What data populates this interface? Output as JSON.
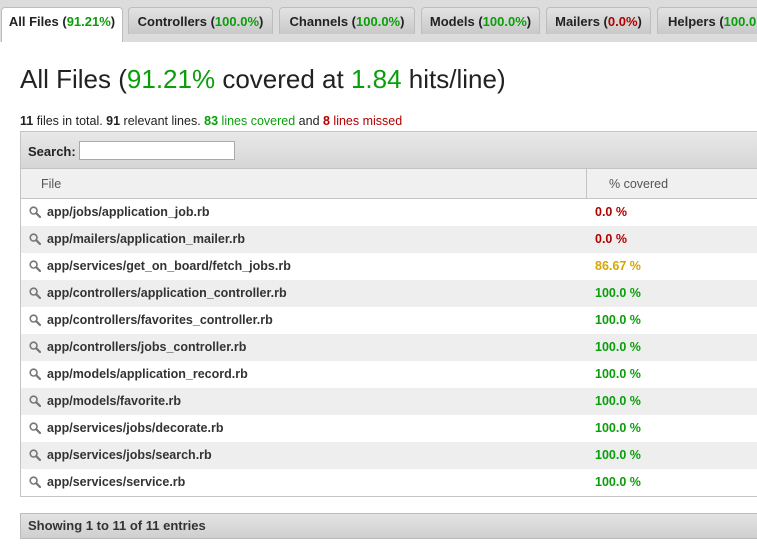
{
  "tabs": [
    {
      "label": "All Files",
      "pct": "91.21%",
      "pct_color": "green",
      "active": true
    },
    {
      "label": "Controllers",
      "pct": "100.0%",
      "pct_color": "green",
      "active": false
    },
    {
      "label": "Channels",
      "pct": "100.0%",
      "pct_color": "green",
      "active": false
    },
    {
      "label": "Models",
      "pct": "100.0%",
      "pct_color": "green",
      "active": false
    },
    {
      "label": "Mailers",
      "pct": "0.0%",
      "pct_color": "red",
      "active": false
    },
    {
      "label": "Helpers",
      "pct": "100.0",
      "pct_color": "green",
      "active": false
    }
  ],
  "header": {
    "title_prefix": "All Files (",
    "covered_pct": "91.21%",
    "title_mid": " covered at ",
    "hits": "1.84",
    "title_suffix": " hits/line)"
  },
  "summary": {
    "files_count": "11",
    "files_text": " files in total. ",
    "relevant_count": "91",
    "relevant_text": " relevant lines. ",
    "covered_count": "83",
    "covered_text": " lines covered",
    "and_text": " and ",
    "missed_count": "8",
    "missed_text": " lines missed"
  },
  "search": {
    "label": "Search:",
    "value": ""
  },
  "table": {
    "columns": [
      "File",
      "% covered"
    ],
    "rows": [
      {
        "file": "app/jobs/application_job.rb",
        "coverage": "0.0 %",
        "color": "#b00000"
      },
      {
        "file": "app/mailers/application_mailer.rb",
        "coverage": "0.0 %",
        "color": "#b00000"
      },
      {
        "file": "app/services/get_on_board/fetch_jobs.rb",
        "coverage": "86.67 %",
        "color": "#d6a600"
      },
      {
        "file": "app/controllers/application_controller.rb",
        "coverage": "100.0 %",
        "color": "#0a9e0a"
      },
      {
        "file": "app/controllers/favorites_controller.rb",
        "coverage": "100.0 %",
        "color": "#0a9e0a"
      },
      {
        "file": "app/controllers/jobs_controller.rb",
        "coverage": "100.0 %",
        "color": "#0a9e0a"
      },
      {
        "file": "app/models/application_record.rb",
        "coverage": "100.0 %",
        "color": "#0a9e0a"
      },
      {
        "file": "app/models/favorite.rb",
        "coverage": "100.0 %",
        "color": "#0a9e0a"
      },
      {
        "file": "app/services/jobs/decorate.rb",
        "coverage": "100.0 %",
        "color": "#0a9e0a"
      },
      {
        "file": "app/services/jobs/search.rb",
        "coverage": "100.0 %",
        "color": "#0a9e0a"
      },
      {
        "file": "app/services/service.rb",
        "coverage": "100.0 %",
        "color": "#0a9e0a"
      }
    ]
  },
  "footer": {
    "text": "Showing 1 to 11 of 11 entries"
  },
  "colors": {
    "green": "#0a9e0a",
    "red": "#b00000",
    "yellow": "#d6a600"
  },
  "icons": {
    "row_icon": "magnifier-icon"
  }
}
